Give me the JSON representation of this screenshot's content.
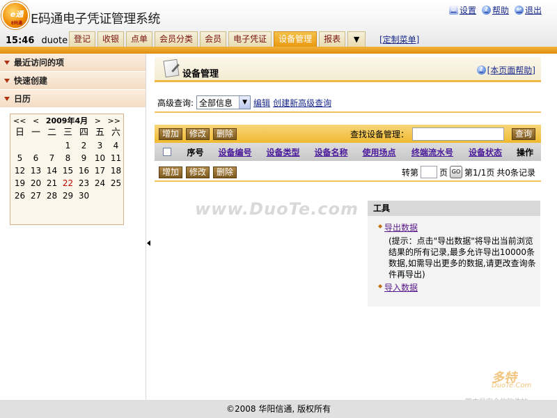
{
  "app": {
    "title": "E码通电子凭证管理系统",
    "logo_text": "e通",
    "logo_sub": "E码通"
  },
  "top_links": [
    {
      "label": "设置",
      "icon": "settings-icon"
    },
    {
      "label": "帮助",
      "icon": "help-icon"
    },
    {
      "label": "退出",
      "icon": "logout-icon"
    }
  ],
  "status": {
    "time": "15:46",
    "user": "duote"
  },
  "tabs": [
    "登记",
    "收银",
    "点单",
    "会员分类",
    "会员",
    "电子凭证",
    "设备管理",
    "报表"
  ],
  "active_tab": "设备管理",
  "custom_menu": "[定制菜单]",
  "sidebar": {
    "sections": [
      "最近访问的项",
      "快速创建",
      "日历"
    ]
  },
  "calendar": {
    "prev_year": "<<",
    "prev_month": "<",
    "title": "2009年4月",
    "next_month": ">",
    "next_year": ">>",
    "weekdays": [
      "日",
      "一",
      "二",
      "三",
      "四",
      "五",
      "六"
    ],
    "weeks": [
      [
        "",
        "",
        "",
        "1",
        "2",
        "3",
        "4"
      ],
      [
        "5",
        "6",
        "7",
        "8",
        "9",
        "10",
        "11"
      ],
      [
        "12",
        "13",
        "14",
        "15",
        "16",
        "17",
        "18"
      ],
      [
        "19",
        "20",
        "21",
        "22",
        "23",
        "24",
        "25"
      ],
      [
        "26",
        "27",
        "28",
        "29",
        "30",
        "",
        ""
      ]
    ],
    "today": "22"
  },
  "page": {
    "title": "设备管理",
    "help_link": "[本页面帮助]",
    "adv_label": "高级查询:",
    "adv_value": "全部信息",
    "edit_link": "编辑",
    "create_link": "创建新高级查询"
  },
  "toolbar": {
    "add": "增加",
    "edit": "修改",
    "delete": "删除",
    "search_label": "查找设备管理：",
    "search_value": "",
    "search_button": "查询"
  },
  "table": {
    "columns": [
      "序号",
      "设备编号",
      "设备类型",
      "设备名称",
      "使用场点",
      "终端流水号",
      "设备状态",
      "操作"
    ]
  },
  "pager": {
    "jump_label": "转第",
    "page_unit": "页",
    "go": "GO",
    "page_info": "第1/1页",
    "total": "共0条记录"
  },
  "watermark": "www.DuoTe.com",
  "tools": {
    "title": "工具",
    "export_link": "导出数据",
    "note": "(提示：点击\"导出数据\"将导出当前浏览结果的所有记录,最多允许导出10000条数据,如需导出更多的数据,请更改查询条件再导出)",
    "import_link": "导入数据"
  },
  "corner_logo": {
    "main": "多特",
    "sub": "DuoTe.Com",
    "tag": "国内最安全的软件站"
  },
  "footer": "©2008 华阳信通, 版权所有"
}
